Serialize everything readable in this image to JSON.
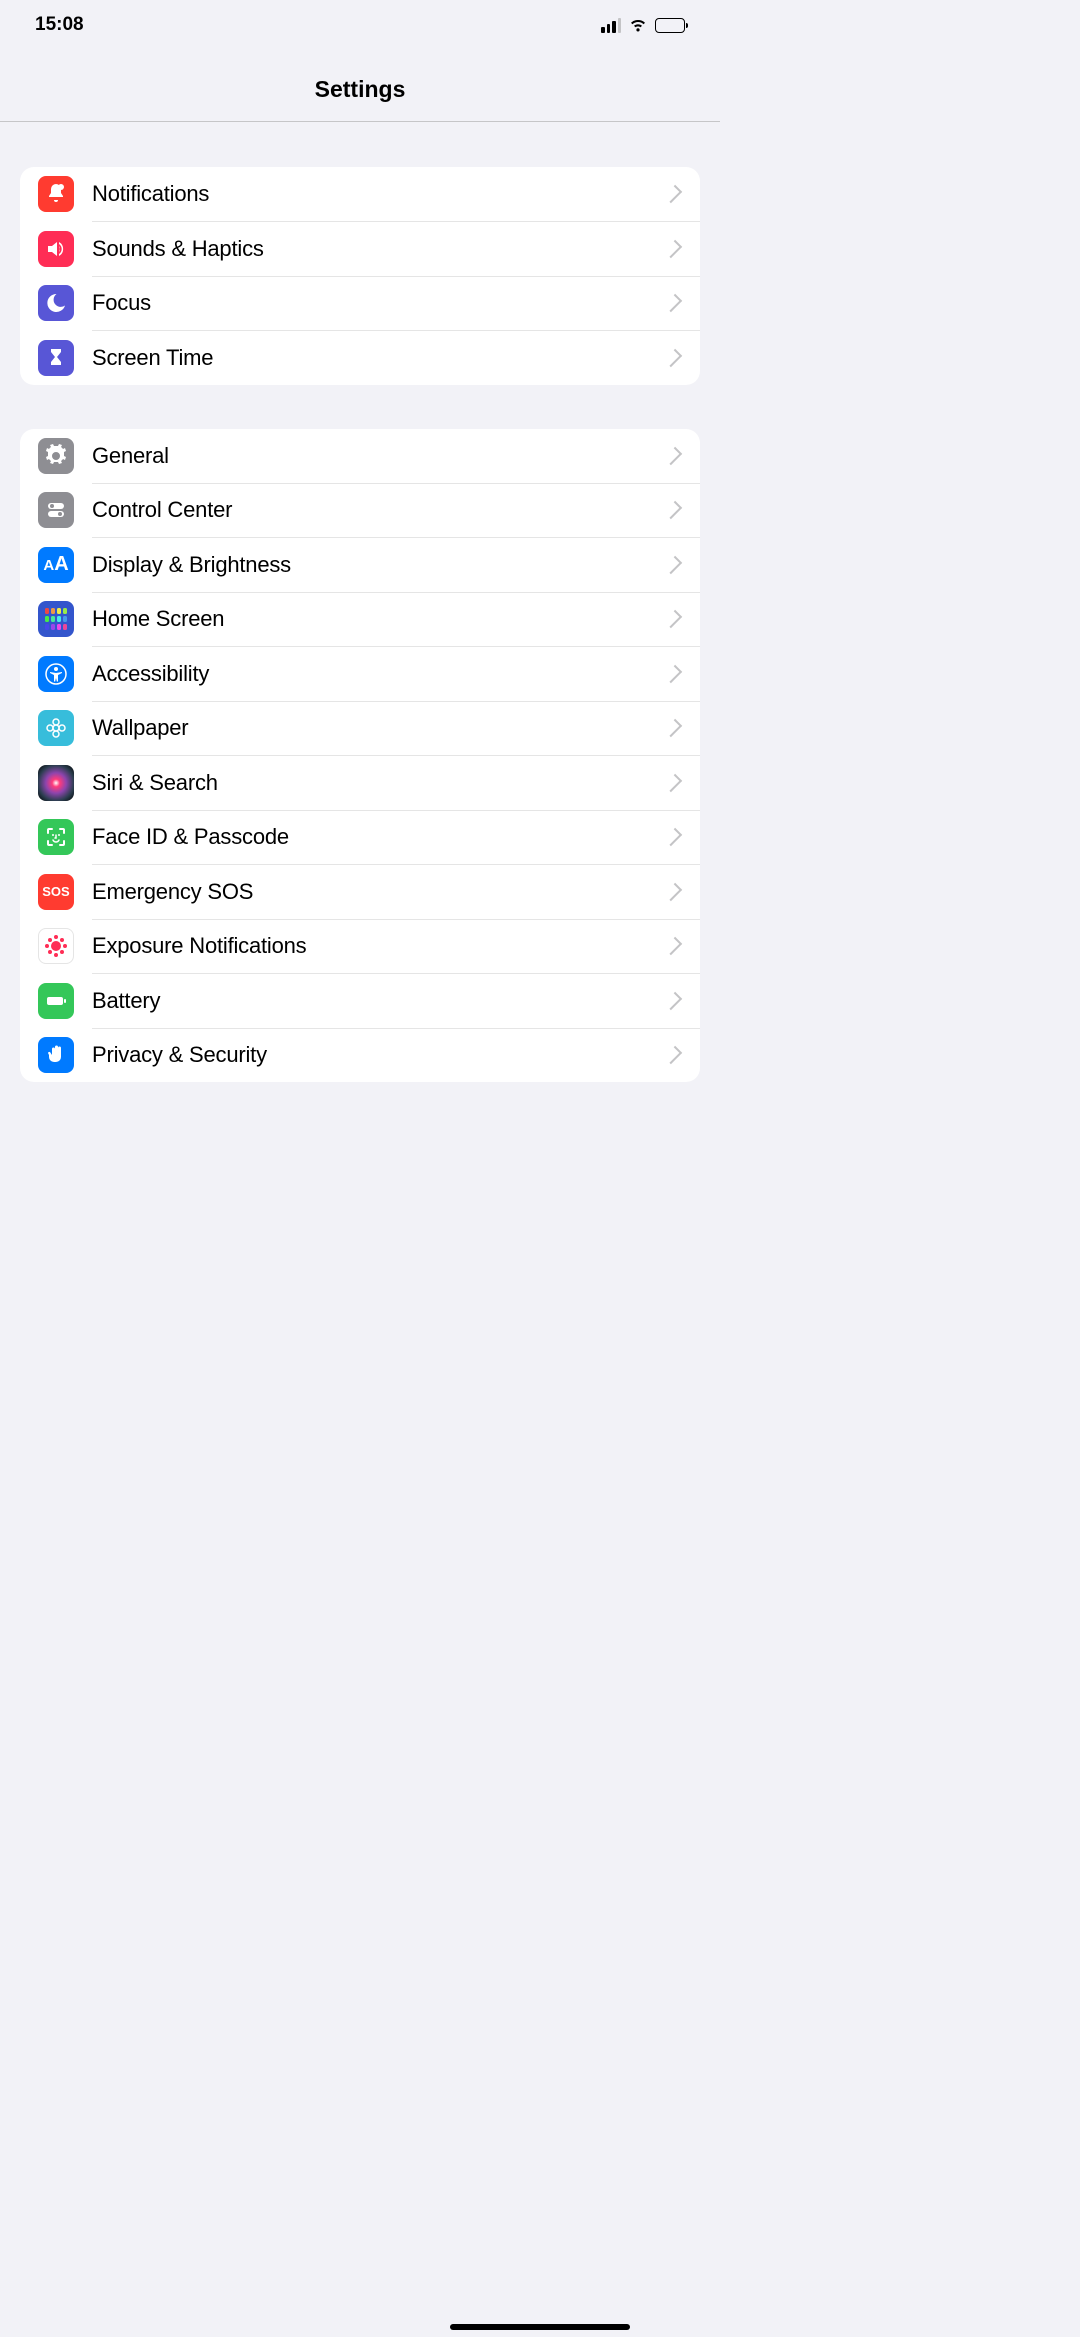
{
  "status": {
    "time": "15:08"
  },
  "header": {
    "title": "Settings"
  },
  "groups": [
    {
      "items": [
        {
          "label": "Notifications",
          "icon": "bell-icon",
          "color": "#ff3b30"
        },
        {
          "label": "Sounds & Haptics",
          "icon": "speaker-icon",
          "color": "#ff2d55"
        },
        {
          "label": "Focus",
          "icon": "moon-icon",
          "color": "#5856d6"
        },
        {
          "label": "Screen Time",
          "icon": "hourglass-icon",
          "color": "#5856d6"
        }
      ]
    },
    {
      "items": [
        {
          "label": "General",
          "icon": "gear-icon",
          "color": "#8e8e93"
        },
        {
          "label": "Control Center",
          "icon": "switches-icon",
          "color": "#8e8e93"
        },
        {
          "label": "Display & Brightness",
          "icon": "text-size-icon",
          "color": "#007aff"
        },
        {
          "label": "Home Screen",
          "icon": "grid-icon",
          "color": "#3355cc"
        },
        {
          "label": "Accessibility",
          "icon": "accessibility-icon",
          "color": "#007aff"
        },
        {
          "label": "Wallpaper",
          "icon": "flower-icon",
          "color": "#37bddb"
        },
        {
          "label": "Siri & Search",
          "icon": "siri-icon",
          "color": "siri"
        },
        {
          "label": "Face ID & Passcode",
          "icon": "faceid-icon",
          "color": "#34c759"
        },
        {
          "label": "Emergency SOS",
          "icon": "sos-icon",
          "color": "#ff3b30"
        },
        {
          "label": "Exposure Notifications",
          "icon": "exposure-icon",
          "color": "#ffffff"
        },
        {
          "label": "Battery",
          "icon": "battery-icon",
          "color": "#34c759"
        },
        {
          "label": "Privacy & Security",
          "icon": "hand-icon",
          "color": "#007aff"
        }
      ]
    }
  ]
}
